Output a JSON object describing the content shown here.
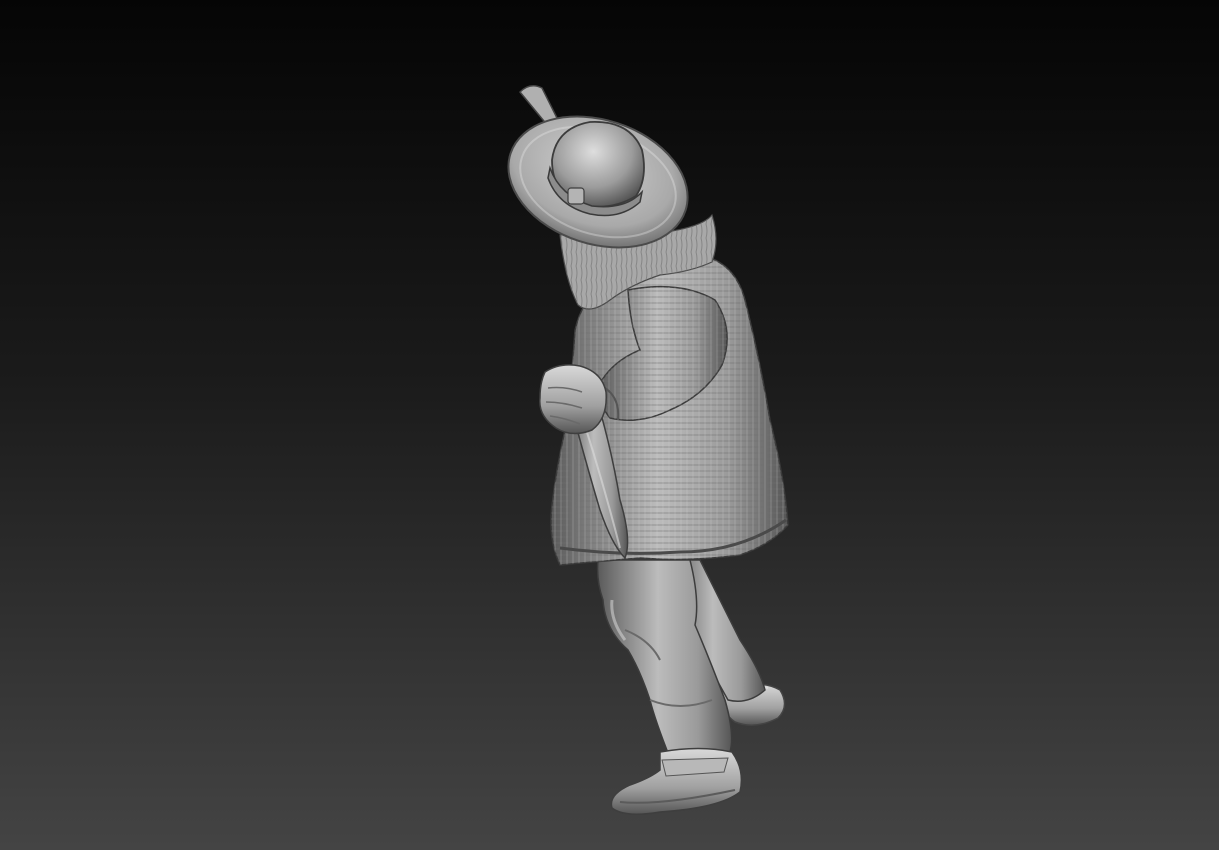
{
  "viewport": {
    "background_top_color": "#050505",
    "background_bottom_color": "#444444",
    "model_base_color": "#9a9a9a",
    "model_highlight_color": "#d6d6d6",
    "model_shadow_color": "#3c3c3c"
  },
  "model": {
    "subject": "clay-render-figure"
  }
}
